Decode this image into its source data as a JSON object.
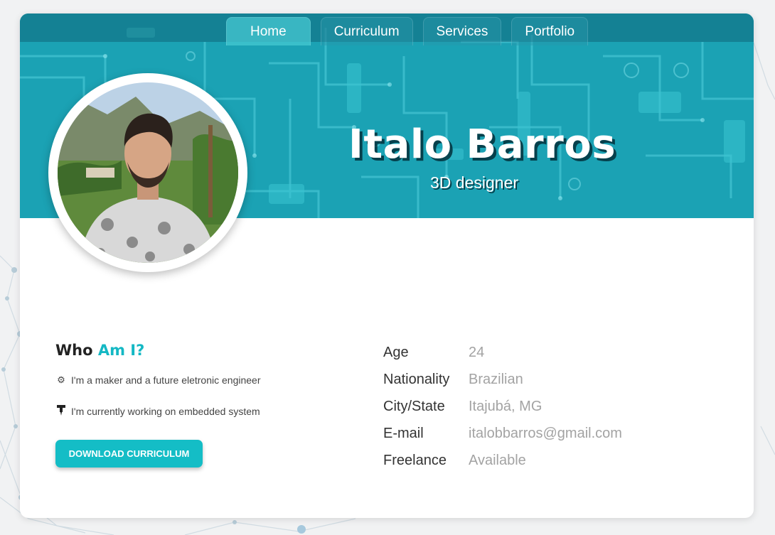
{
  "nav": {
    "items": [
      {
        "label": "Home",
        "active": true
      },
      {
        "label": "Curriculum",
        "active": false
      },
      {
        "label": "Services",
        "active": false
      },
      {
        "label": "Portfolio",
        "active": false
      }
    ]
  },
  "hero": {
    "name": "Italo Barros",
    "role": "3D designer"
  },
  "about": {
    "title_prefix": "Who",
    "title_accent": "Am I?",
    "lines": [
      {
        "icon": "gear-icon",
        "text": "I'm a maker and a future eletronic engineer"
      },
      {
        "icon": "soldering-iron-icon",
        "text": "I'm currently working on embedded system"
      }
    ],
    "download_label": "DOWNLOAD CURRICULUM"
  },
  "info": [
    {
      "label": "Age",
      "value": "24"
    },
    {
      "label": "Nationality",
      "value": "Brazilian"
    },
    {
      "label": "City/State",
      "value": "Itajubá, MG"
    },
    {
      "label": "E-mail",
      "value": "italobbarros@gmail.com"
    },
    {
      "label": "Freelance",
      "value": "Available"
    }
  ],
  "colors": {
    "accent": "#14b8c4",
    "hero_bg": "#1ba2b4",
    "button": "#14bdc6"
  }
}
